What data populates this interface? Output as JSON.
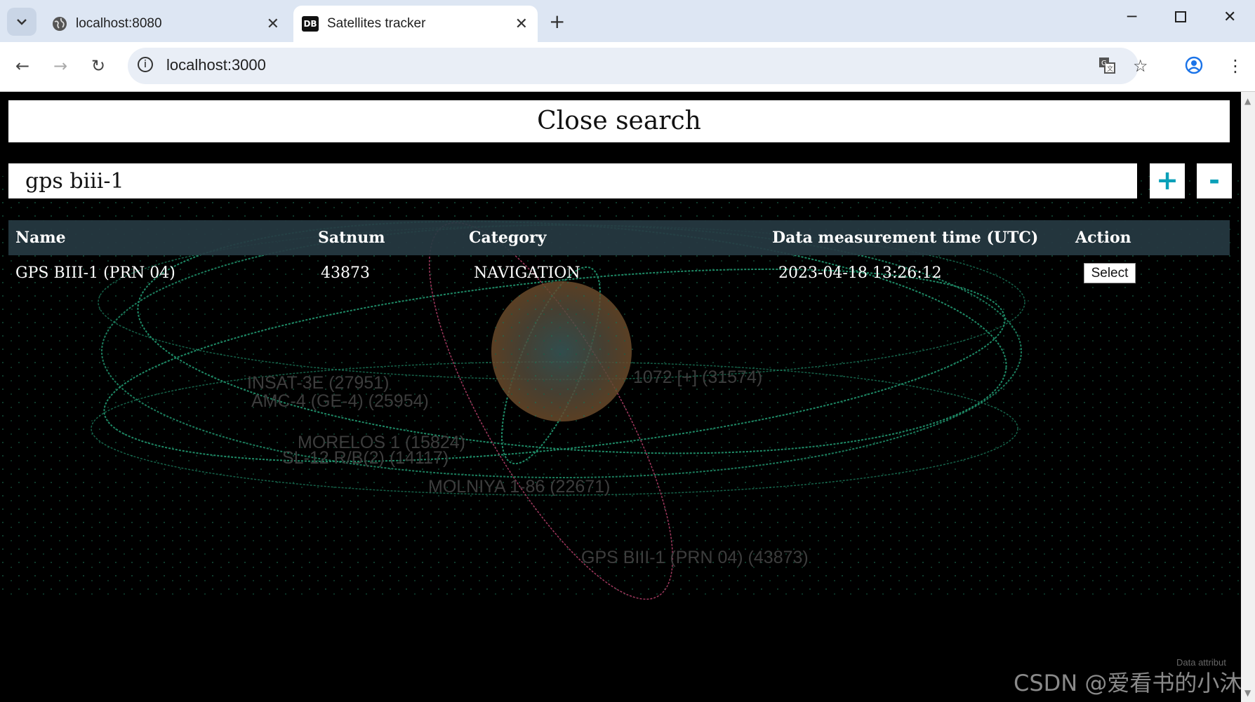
{
  "browser": {
    "tabs": [
      {
        "title": "localhost:8080",
        "favicon": "globe-icon"
      },
      {
        "title": "Satellites tracker",
        "favicon": "db-icon",
        "favicon_text": "DB"
      }
    ],
    "new_tab_glyph": "+",
    "url": "localhost:3000"
  },
  "page": {
    "close_search_label": "Close search",
    "search": {
      "value": "gps biii-1",
      "placeholder": ""
    },
    "plus_label": "+",
    "minus_label": "-",
    "table": {
      "headers": [
        "Name",
        "Satnum",
        "Category",
        "Data measurement time (UTC)",
        "Action"
      ],
      "rows": [
        {
          "name": "GPS BIII-1 (PRN 04)",
          "satnum": "43873",
          "category": "NAVIGATION",
          "time": "2023-04-18 13:26:12",
          "action": "Select"
        }
      ]
    },
    "satellite_labels": [
      "INSAT-3E (27951)",
      "AMC-4 (GE-4) (25954)",
      "MORELOS 1 (15824)",
      "SL-12 R/B(2) (14117)",
      "MOLNIYA 1-86 (22671)",
      "1072 [+] (31574)",
      "GPS BIII-1  (PRN 04) (43873)"
    ],
    "attribution": "Data attribut",
    "watermark": "CSDN @爱看书的小沐"
  },
  "colors": {
    "orbit_green": "#1e8a66",
    "orbit_pink": "#a0385e",
    "header_bg": "#263a42",
    "accent": "#0aa0b8"
  }
}
